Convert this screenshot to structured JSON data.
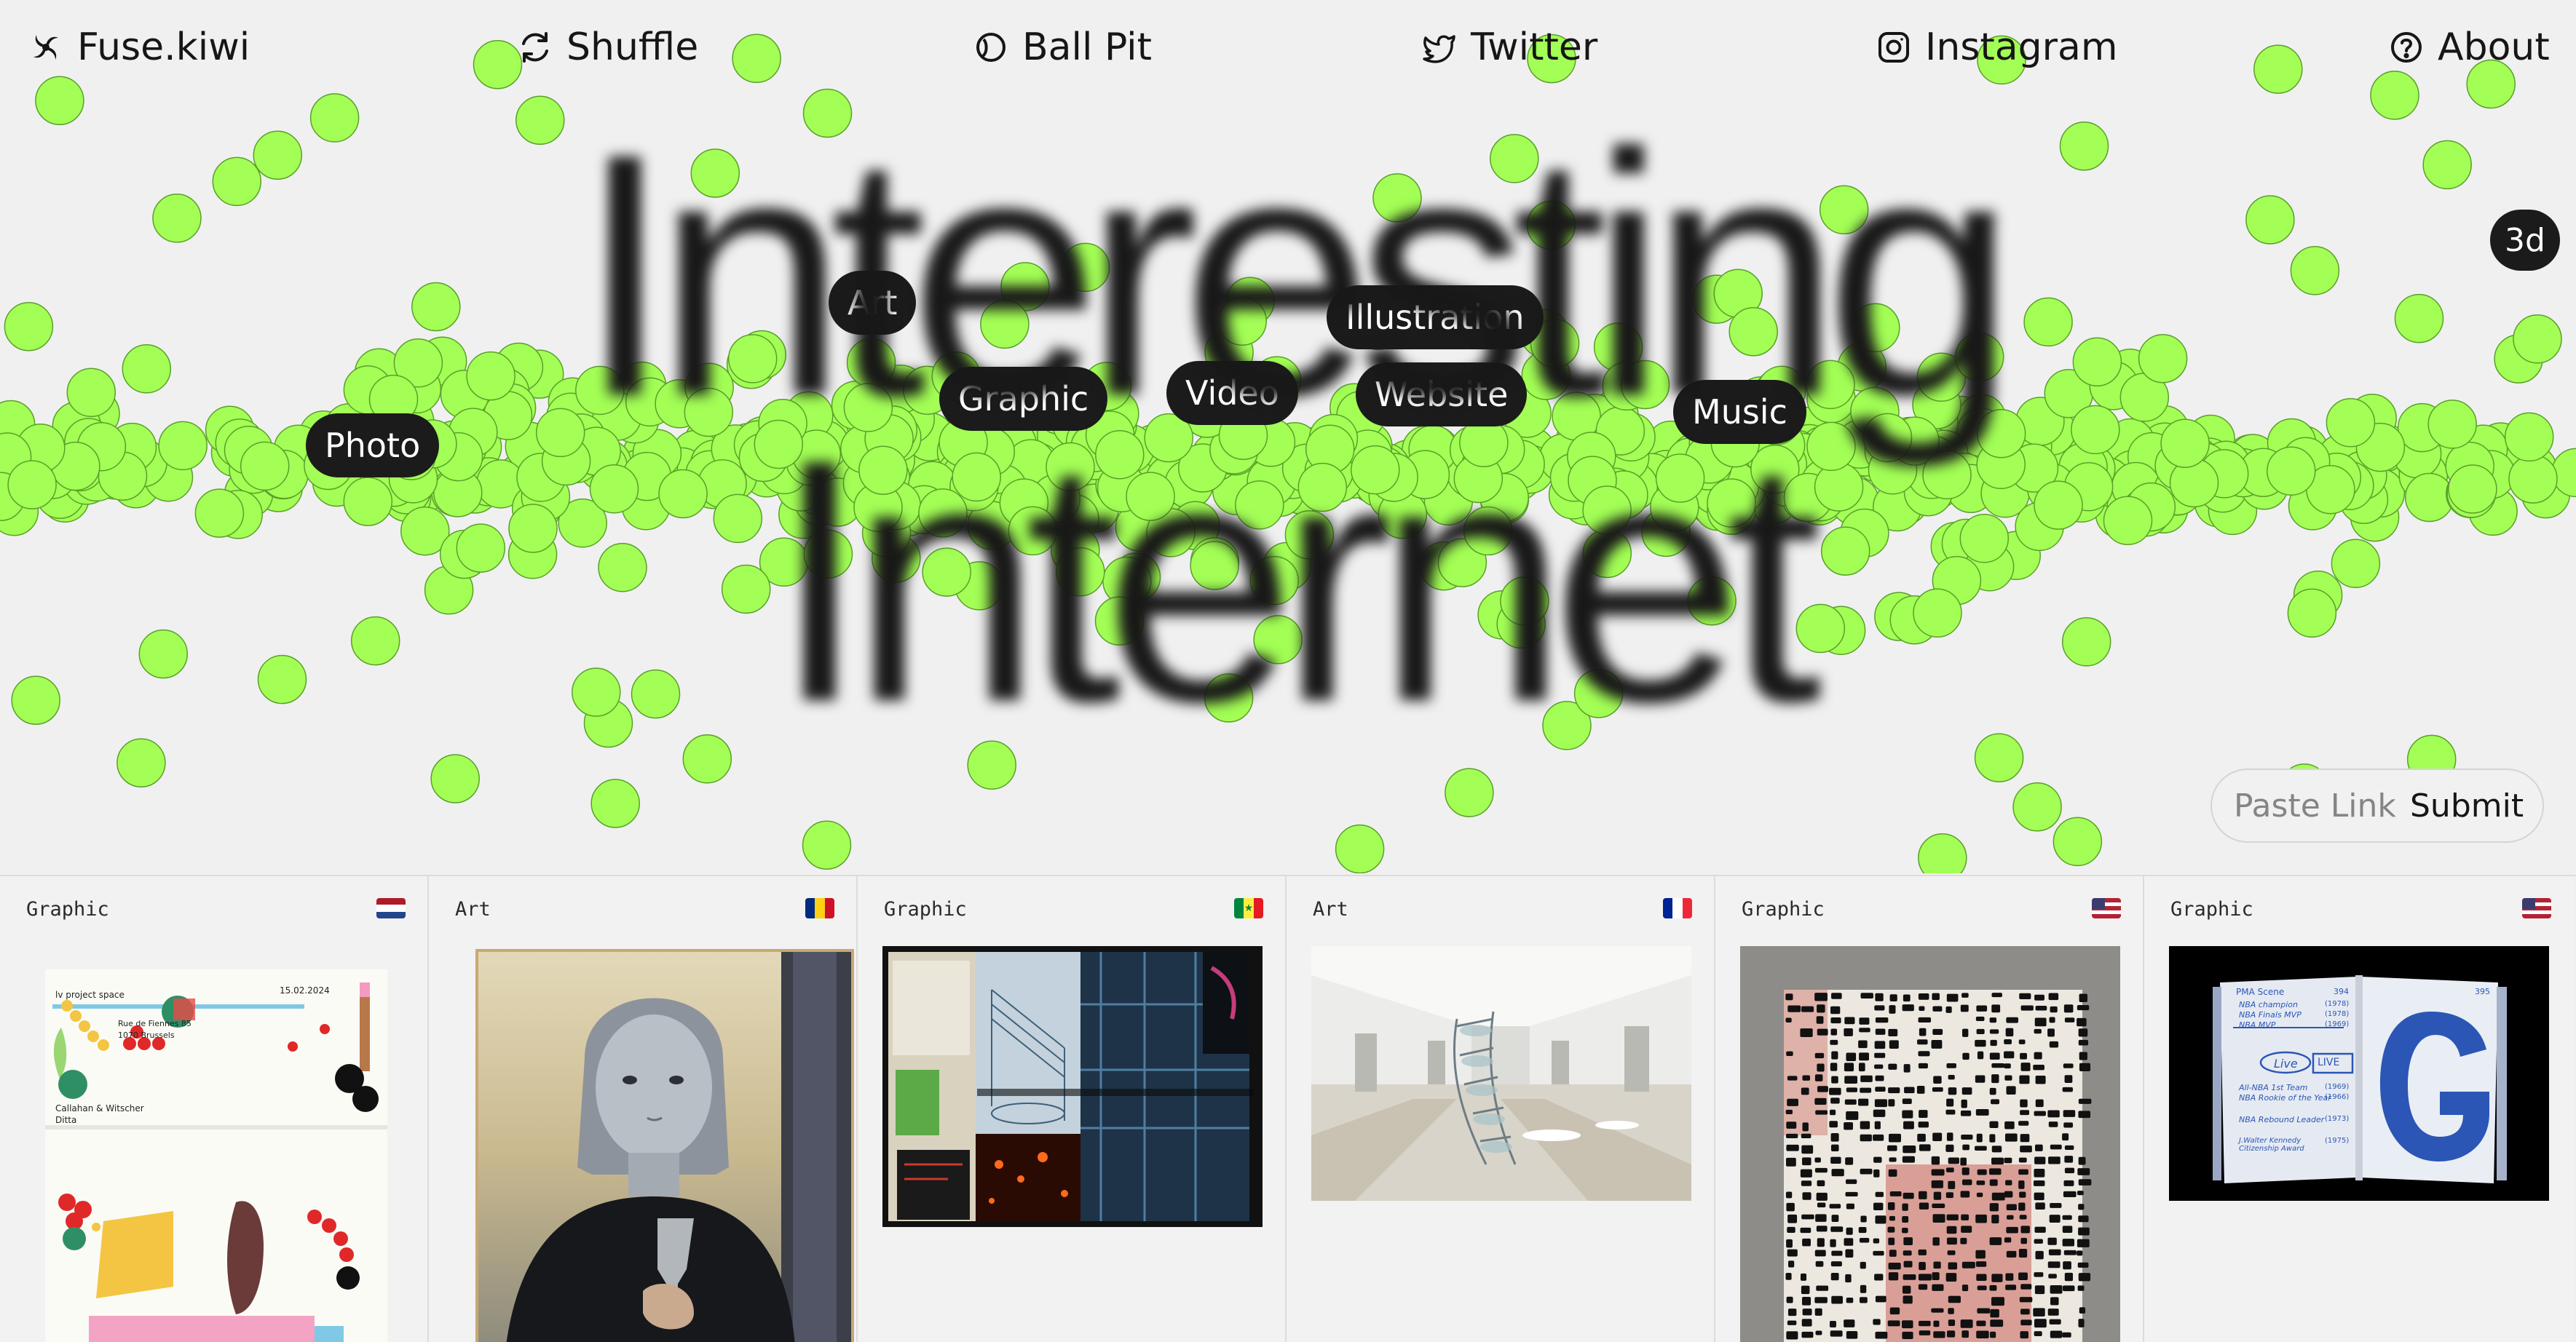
{
  "nav": {
    "logo": "Fuse.kiwi",
    "shuffle": "Shuffle",
    "ball_pit": "Ball Pit",
    "twitter": "Twitter",
    "instagram": "Instagram",
    "about": "About"
  },
  "hero": {
    "headline_line1": "Interesting",
    "headline_line2": "Internet",
    "badge_3d": "3d",
    "tags": [
      "Photo",
      "Art",
      "Graphic",
      "Video",
      "Website",
      "Illustration",
      "Music"
    ]
  },
  "submit": {
    "placeholder": "Paste Link",
    "button_label": "Submit"
  },
  "cards": [
    {
      "category": "Graphic",
      "flag": "netherlands"
    },
    {
      "category": "Art",
      "flag": "romania"
    },
    {
      "category": "Graphic",
      "flag": "senegal"
    },
    {
      "category": "Art",
      "flag": "france"
    },
    {
      "category": "Graphic",
      "flag": "usa"
    },
    {
      "category": "Graphic",
      "flag": "usa"
    }
  ],
  "card_images": {
    "poster_date": "15.02.2024",
    "poster_venue": "lv project space",
    "poster_address": "Rue de Fiennes 85",
    "poster_city": "1070 Brussels",
    "poster_artists": "Callahan & Witscher",
    "poster_extra": "Ditta",
    "book_heading": "PMA Scene",
    "book_page_left": "394",
    "book_page_right": "395",
    "book_lines": [
      "NBA champion",
      "NBA Finals MVP",
      "NBA MVP",
      "All-NBA 1st Team",
      "NBA Rookie of the Year",
      "NBA Rebound Leader",
      "J.Walter Kennedy Citizenship Award"
    ],
    "book_years": [
      "(1978)",
      "(1978)",
      "(1969)",
      "(1969)",
      "(1966)",
      "(1973)",
      "(1975)"
    ],
    "book_live_a": "Live",
    "book_live_b": "LIVE",
    "book_letter": "G"
  },
  "colors": {
    "ball": "#a3ff55",
    "ball_stroke": "#5aa02a",
    "background": "#f0f0f0",
    "text": "#161616",
    "tag_bg": "#1b1b1b"
  }
}
